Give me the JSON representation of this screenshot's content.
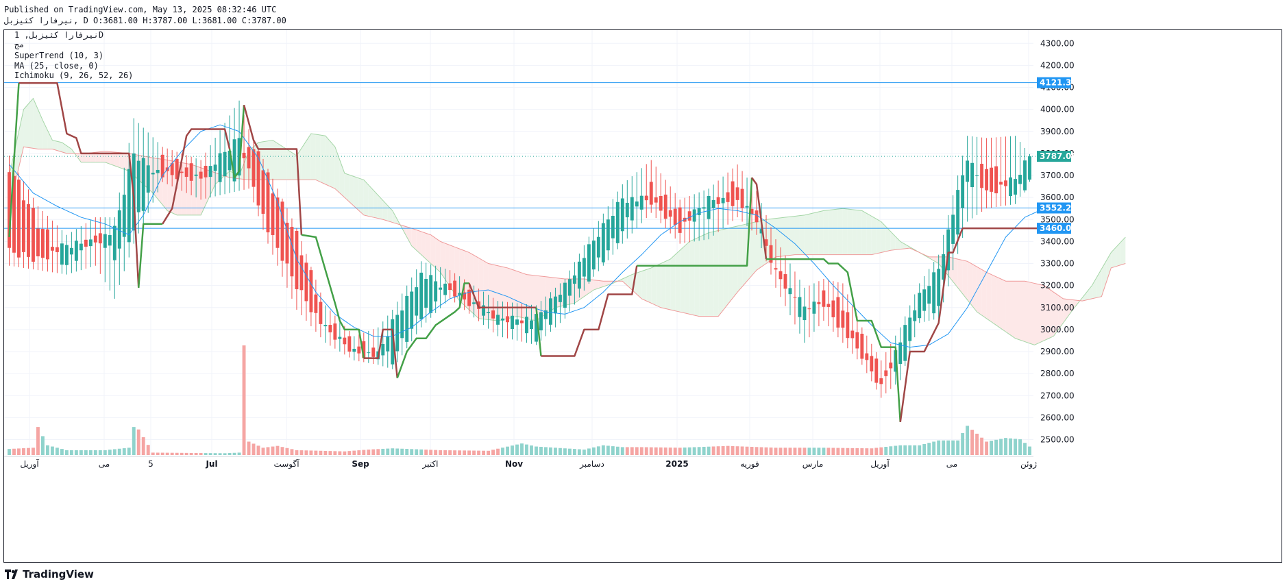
{
  "header": {
    "published": "Published on TradingView.com, May 13, 2025 08:32:46 UTC",
    "ohlc": "نیرفارا کثیزبل, D O:3681.00 H:3787.00 L:3681.00 C:3787.00"
  },
  "legend": {
    "symbol": "نیرفارا کثیزبل, 1D",
    "exchange": "مج",
    "indicators": [
      "SuperTrend (10, 3)",
      "MA (25, close, 0)",
      "Ichimoku (9, 26, 52, 26)"
    ]
  },
  "branding": {
    "logo_text": "TradingView"
  },
  "colors": {
    "up": "#26a69a",
    "down": "#ef5350",
    "ma": "#2196f3",
    "supertrend_up": "#43a047",
    "supertrend_down": "#a04646",
    "kumo_bull_fill": "#e8f5e9",
    "kumo_bear_fill": "#fde8e8",
    "hline": "#2196f3",
    "last_price_tag": "#26a69a"
  },
  "chart_data": {
    "type": "candlestick",
    "interval": "1D",
    "ylim": [
      2430,
      4360
    ],
    "y_ticks": [
      "4300.00",
      "4200.00",
      "4100.00",
      "4000.00",
      "3900.00",
      "3800.00",
      "3700.00",
      "3600.00",
      "3500.00",
      "3400.00",
      "3300.00",
      "3200.00",
      "3100.00",
      "3000.00",
      "2900.00",
      "2800.00",
      "2700.00",
      "2600.00",
      "2500.00"
    ],
    "x_tick_labels": [
      "آوریل",
      "می",
      "5",
      "Jul",
      "آگوست",
      "Sep",
      "اکتبر",
      "Nov",
      "دسامبر",
      "2025",
      "فوریه",
      "مارس",
      "آوریل",
      "می",
      "ژوئن"
    ],
    "x_tick_bold": [
      "Jul",
      "Sep",
      "Nov",
      "2025"
    ],
    "horizontal_levels": [
      4121.34,
      3552.28,
      3460.0
    ],
    "level_labels": [
      "4121.34",
      "3552.28",
      "3460.00"
    ],
    "last_price": 3787.0,
    "last_price_label": "3787.00",
    "supertrend_keypoints": [
      [
        0,
        3420
      ],
      [
        2,
        4120
      ],
      [
        10,
        4120
      ],
      [
        12,
        3890
      ],
      [
        14,
        3870
      ],
      [
        15,
        3800
      ],
      [
        25,
        3800
      ],
      [
        26,
        3600
      ],
      [
        27,
        3190
      ],
      [
        28,
        3480
      ],
      [
        32,
        3480
      ],
      [
        34,
        3550
      ],
      [
        37,
        3880
      ],
      [
        38,
        3910
      ],
      [
        45,
        3910
      ],
      [
        46,
        3820
      ],
      [
        47,
        3690
      ],
      [
        48,
        3720
      ],
      [
        49,
        4020
      ],
      [
        51,
        3860
      ],
      [
        52,
        3820
      ],
      [
        60,
        3820
      ],
      [
        61,
        3430
      ],
      [
        64,
        3420
      ],
      [
        68,
        3120
      ],
      [
        69,
        3040
      ],
      [
        70,
        3000
      ],
      [
        73,
        3000
      ],
      [
        74,
        2870
      ],
      [
        77,
        2870
      ],
      [
        78,
        3000
      ],
      [
        80,
        3000
      ],
      [
        81,
        2780
      ],
      [
        83,
        2900
      ],
      [
        85,
        2960
      ],
      [
        87,
        2960
      ],
      [
        89,
        3020
      ],
      [
        93,
        3080
      ],
      [
        94,
        3100
      ],
      [
        95,
        3210
      ],
      [
        96,
        3210
      ],
      [
        98,
        3100
      ],
      [
        110,
        3100
      ],
      [
        111,
        2880
      ],
      [
        118,
        2880
      ],
      [
        120,
        3000
      ],
      [
        123,
        3000
      ],
      [
        125,
        3160
      ],
      [
        130,
        3160
      ],
      [
        131,
        3290
      ],
      [
        154,
        3290
      ],
      [
        155,
        3690
      ],
      [
        156,
        3660
      ],
      [
        158,
        3320
      ],
      [
        170,
        3320
      ],
      [
        171,
        3300
      ],
      [
        173,
        3300
      ],
      [
        175,
        3260
      ],
      [
        177,
        3040
      ],
      [
        180,
        3040
      ],
      [
        182,
        2920
      ],
      [
        185,
        2920
      ],
      [
        186,
        2580
      ],
      [
        188,
        2900
      ],
      [
        191,
        2900
      ],
      [
        194,
        3030
      ],
      [
        196,
        3350
      ],
      [
        197,
        3350
      ],
      [
        199,
        3460
      ],
      [
        217,
        3460
      ]
    ],
    "supertrend_direction_changes": [
      2,
      27,
      32,
      46,
      49,
      61,
      74,
      81,
      96,
      110,
      111,
      131,
      155,
      158,
      186
    ],
    "ma25_keypoints": [
      [
        0,
        3750
      ],
      [
        5,
        3620
      ],
      [
        10,
        3560
      ],
      [
        15,
        3510
      ],
      [
        20,
        3480
      ],
      [
        25,
        3430
      ],
      [
        28,
        3520
      ],
      [
        32,
        3700
      ],
      [
        36,
        3810
      ],
      [
        40,
        3900
      ],
      [
        44,
        3930
      ],
      [
        48,
        3900
      ],
      [
        52,
        3780
      ],
      [
        56,
        3580
      ],
      [
        60,
        3320
      ],
      [
        64,
        3170
      ],
      [
        68,
        3070
      ],
      [
        72,
        3010
      ],
      [
        76,
        2970
      ],
      [
        80,
        2970
      ],
      [
        84,
        3010
      ],
      [
        88,
        3080
      ],
      [
        92,
        3140
      ],
      [
        96,
        3170
      ],
      [
        100,
        3180
      ],
      [
        104,
        3150
      ],
      [
        108,
        3110
      ],
      [
        112,
        3080
      ],
      [
        116,
        3070
      ],
      [
        120,
        3100
      ],
      [
        124,
        3170
      ],
      [
        128,
        3260
      ],
      [
        132,
        3340
      ],
      [
        136,
        3430
      ],
      [
        140,
        3490
      ],
      [
        144,
        3530
      ],
      [
        148,
        3550
      ],
      [
        152,
        3540
      ],
      [
        156,
        3520
      ],
      [
        160,
        3460
      ],
      [
        164,
        3390
      ],
      [
        168,
        3300
      ],
      [
        172,
        3200
      ],
      [
        176,
        3110
      ],
      [
        180,
        3020
      ],
      [
        184,
        2940
      ],
      [
        188,
        2920
      ],
      [
        192,
        2930
      ],
      [
        196,
        2980
      ],
      [
        200,
        3100
      ],
      [
        204,
        3260
      ],
      [
        208,
        3420
      ],
      [
        212,
        3510
      ],
      [
        216,
        3550
      ]
    ],
    "kumo_span_a_keypoints": [
      [
        0,
        3700
      ],
      [
        3,
        4000
      ],
      [
        5,
        4050
      ],
      [
        7,
        3950
      ],
      [
        9,
        3860
      ],
      [
        11,
        3850
      ],
      [
        13,
        3820
      ],
      [
        15,
        3760
      ],
      [
        20,
        3760
      ],
      [
        25,
        3720
      ],
      [
        30,
        3620
      ],
      [
        33,
        3540
      ],
      [
        35,
        3520
      ],
      [
        40,
        3520
      ],
      [
        43,
        3660
      ],
      [
        46,
        3720
      ],
      [
        48,
        3700
      ],
      [
        50,
        3810
      ],
      [
        52,
        3850
      ],
      [
        55,
        3860
      ],
      [
        60,
        3790
      ],
      [
        63,
        3890
      ],
      [
        66,
        3880
      ],
      [
        68,
        3830
      ],
      [
        70,
        3710
      ],
      [
        74,
        3680
      ],
      [
        80,
        3540
      ],
      [
        84,
        3380
      ],
      [
        88,
        3300
      ],
      [
        90,
        3260
      ],
      [
        94,
        3130
      ],
      [
        98,
        3050
      ],
      [
        102,
        3040
      ],
      [
        106,
        3060
      ],
      [
        110,
        3040
      ],
      [
        114,
        3100
      ],
      [
        118,
        3120
      ],
      [
        122,
        3180
      ],
      [
        126,
        3210
      ],
      [
        130,
        3250
      ],
      [
        134,
        3280
      ],
      [
        138,
        3320
      ],
      [
        142,
        3400
      ],
      [
        146,
        3440
      ],
      [
        150,
        3460
      ],
      [
        154,
        3480
      ],
      [
        158,
        3500
      ],
      [
        162,
        3510
      ],
      [
        166,
        3520
      ],
      [
        170,
        3540
      ],
      [
        174,
        3550
      ],
      [
        178,
        3540
      ],
      [
        182,
        3490
      ],
      [
        186,
        3400
      ],
      [
        190,
        3350
      ],
      [
        194,
        3300
      ],
      [
        198,
        3190
      ],
      [
        202,
        3080
      ],
      [
        206,
        3020
      ],
      [
        210,
        2960
      ],
      [
        214,
        2930
      ],
      [
        218,
        2970
      ],
      [
        222,
        3090
      ],
      [
        226,
        3200
      ],
      [
        230,
        3350
      ],
      [
        233,
        3420
      ]
    ],
    "kumo_span_b_keypoints": [
      [
        0,
        3550
      ],
      [
        3,
        3830
      ],
      [
        6,
        3820
      ],
      [
        9,
        3820
      ],
      [
        12,
        3800
      ],
      [
        16,
        3800
      ],
      [
        20,
        3810
      ],
      [
        25,
        3800
      ],
      [
        30,
        3780
      ],
      [
        33,
        3770
      ],
      [
        38,
        3750
      ],
      [
        42,
        3720
      ],
      [
        46,
        3690
      ],
      [
        50,
        3680
      ],
      [
        60,
        3680
      ],
      [
        64,
        3680
      ],
      [
        66,
        3660
      ],
      [
        68,
        3640
      ],
      [
        70,
        3600
      ],
      [
        74,
        3520
      ],
      [
        78,
        3500
      ],
      [
        84,
        3460
      ],
      [
        88,
        3430
      ],
      [
        90,
        3400
      ],
      [
        96,
        3350
      ],
      [
        100,
        3300
      ],
      [
        104,
        3280
      ],
      [
        108,
        3250
      ],
      [
        112,
        3240
      ],
      [
        116,
        3230
      ],
      [
        120,
        3230
      ],
      [
        124,
        3220
      ],
      [
        128,
        3220
      ],
      [
        132,
        3140
      ],
      [
        136,
        3100
      ],
      [
        140,
        3080
      ],
      [
        144,
        3060
      ],
      [
        148,
        3060
      ],
      [
        152,
        3170
      ],
      [
        156,
        3270
      ],
      [
        160,
        3330
      ],
      [
        164,
        3340
      ],
      [
        168,
        3340
      ],
      [
        172,
        3340
      ],
      [
        176,
        3340
      ],
      [
        180,
        3340
      ],
      [
        184,
        3360
      ],
      [
        188,
        3370
      ],
      [
        192,
        3330
      ],
      [
        196,
        3330
      ],
      [
        200,
        3310
      ],
      [
        204,
        3260
      ],
      [
        208,
        3220
      ],
      [
        212,
        3220
      ],
      [
        216,
        3200
      ],
      [
        220,
        3140
      ],
      [
        224,
        3130
      ],
      [
        228,
        3150
      ],
      [
        230,
        3280
      ],
      [
        233,
        3300
      ]
    ],
    "candles_ohlc_keypoints": [
      [
        0,
        3750,
        3780,
        3300,
        3350
      ],
      [
        6,
        3480,
        3550,
        3280,
        3320
      ],
      [
        12,
        3300,
        3420,
        3260,
        3380
      ],
      [
        18,
        3420,
        3500,
        3300,
        3400
      ],
      [
        22,
        3350,
        3500,
        3150,
        3450
      ],
      [
        26,
        3450,
        3950,
        3400,
        3800
      ],
      [
        32,
        3780,
        3820,
        3680,
        3700
      ],
      [
        40,
        3710,
        3760,
        3600,
        3690
      ],
      [
        48,
        3700,
        4030,
        3640,
        3870
      ],
      [
        50,
        3850,
        3900,
        3650,
        3720
      ],
      [
        54,
        3700,
        3720,
        3400,
        3450
      ],
      [
        60,
        3420,
        3450,
        3100,
        3200
      ],
      [
        66,
        3050,
        3100,
        2950,
        3000
      ],
      [
        72,
        2920,
        2960,
        2870,
        2900
      ],
      [
        77,
        2900,
        3000,
        2850,
        2880
      ],
      [
        80,
        2870,
        3080,
        2830,
        3030
      ],
      [
        86,
        3060,
        3300,
        3020,
        3250
      ],
      [
        92,
        3210,
        3260,
        3150,
        3180
      ],
      [
        102,
        3050,
        3120,
        2980,
        3050
      ],
      [
        110,
        2980,
        3100,
        2940,
        3050
      ],
      [
        116,
        3120,
        3220,
        3060,
        3200
      ],
      [
        122,
        3280,
        3450,
        3250,
        3400
      ],
      [
        128,
        3440,
        3650,
        3400,
        3600
      ],
      [
        134,
        3650,
        3760,
        3540,
        3580
      ],
      [
        140,
        3520,
        3580,
        3400,
        3460
      ],
      [
        146,
        3530,
        3630,
        3420,
        3590
      ],
      [
        152,
        3660,
        3740,
        3520,
        3580
      ],
      [
        156,
        3520,
        3620,
        3440,
        3500
      ],
      [
        160,
        3300,
        3400,
        3200,
        3260
      ],
      [
        166,
        3050,
        3180,
        2950,
        3100
      ],
      [
        170,
        3150,
        3220,
        3050,
        3120
      ],
      [
        174,
        3100,
        3200,
        2950,
        3000
      ],
      [
        178,
        2960,
        3000,
        2850,
        2880
      ],
      [
        182,
        2800,
        2850,
        2700,
        2740
      ],
      [
        186,
        2830,
        3000,
        2780,
        2950
      ],
      [
        190,
        3080,
        3200,
        3040,
        3150
      ],
      [
        194,
        3100,
        3330,
        3060,
        3280
      ],
      [
        200,
        3650,
        3870,
        3500,
        3780
      ],
      [
        204,
        3750,
        3860,
        3560,
        3620
      ],
      [
        210,
        3620,
        3870,
        3580,
        3680
      ],
      [
        213,
        3681,
        3787,
        3681,
        3787
      ]
    ],
    "volume_keypoints": [
      [
        0,
        50
      ],
      [
        5,
        60
      ],
      [
        6,
        230
      ],
      [
        8,
        80
      ],
      [
        12,
        40
      ],
      [
        20,
        40
      ],
      [
        25,
        60
      ],
      [
        26,
        230
      ],
      [
        27,
        210
      ],
      [
        30,
        20
      ],
      [
        45,
        15
      ],
      [
        48,
        20
      ],
      [
        49,
        900
      ],
      [
        50,
        110
      ],
      [
        53,
        60
      ],
      [
        56,
        75
      ],
      [
        60,
        40
      ],
      [
        70,
        30
      ],
      [
        75,
        45
      ],
      [
        80,
        55
      ],
      [
        90,
        40
      ],
      [
        100,
        35
      ],
      [
        107,
        95
      ],
      [
        110,
        70
      ],
      [
        120,
        45
      ],
      [
        124,
        80
      ],
      [
        128,
        65
      ],
      [
        132,
        65
      ],
      [
        140,
        60
      ],
      [
        150,
        75
      ],
      [
        160,
        60
      ],
      [
        170,
        60
      ],
      [
        180,
        55
      ],
      [
        186,
        80
      ],
      [
        190,
        80
      ],
      [
        194,
        120
      ],
      [
        198,
        120
      ],
      [
        200,
        240
      ],
      [
        204,
        110
      ],
      [
        208,
        140
      ],
      [
        211,
        130
      ],
      [
        213,
        70
      ]
    ]
  }
}
